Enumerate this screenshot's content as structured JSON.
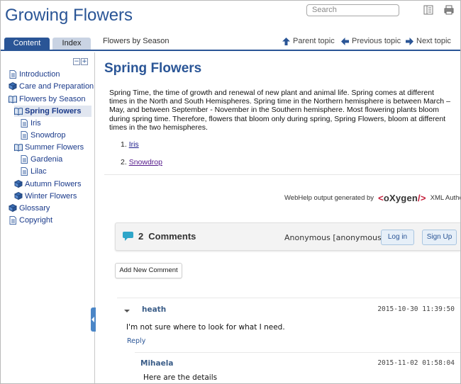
{
  "header": {
    "title": "Growing Flowers",
    "search_placeholder": "Search",
    "toc_icon": "toc-icon",
    "print_icon": "print-icon"
  },
  "tabs": {
    "content": "Content",
    "index": "Index"
  },
  "breadcrumb": "Flowers by Season",
  "nav": {
    "parent": "Parent topic",
    "previous": "Previous topic",
    "next": "Next topic"
  },
  "toc": {
    "items": [
      {
        "label": "Introduction",
        "icon": "page-icon"
      },
      {
        "label": "Care and Preparation",
        "icon": "book-closed-icon"
      },
      {
        "label": "Flowers by Season",
        "icon": "book-open-icon"
      },
      {
        "label": "Spring Flowers",
        "icon": "book-open-icon"
      },
      {
        "label": "Iris",
        "icon": "page-icon"
      },
      {
        "label": "Snowdrop",
        "icon": "page-icon"
      },
      {
        "label": "Summer Flowers",
        "icon": "book-open-icon"
      },
      {
        "label": "Gardenia",
        "icon": "page-icon"
      },
      {
        "label": "Lilac",
        "icon": "page-icon"
      },
      {
        "label": "Autumn Flowers",
        "icon": "book-closed-icon"
      },
      {
        "label": "Winter Flowers",
        "icon": "book-closed-icon"
      },
      {
        "label": "Glossary",
        "icon": "book-closed-icon"
      },
      {
        "label": "Copyright",
        "icon": "page-icon"
      }
    ]
  },
  "topic": {
    "title": "Spring Flowers",
    "body": "Spring Time, the time of growth and renewal of new plant and animal life. Spring comes at different times in the North and South Hemispheres. Spring time in the Northern hemisphere is between March – May, and between September - November in the Southern hemisphere. Most flowering plants bloom during spring time. Therefore, flowers that bloom only during spring, Spring Flowers, bloom at different times in the two hemispheres.",
    "list": [
      {
        "num": "1.",
        "label": "Iris"
      },
      {
        "num": "2.",
        "label": "Snowdrop"
      }
    ]
  },
  "footer": {
    "generated_text": "WebHelp output generated by",
    "logo_text": "oXygen",
    "suffix": "XML Author"
  },
  "comments": {
    "count": "2",
    "label": "Comments",
    "user": "Anonymous [anonymous]",
    "login": "Log in",
    "signup": "Sign Up",
    "add": "Add New Comment",
    "items": [
      {
        "author": "heath",
        "date": "2015-10-30 11:39:50",
        "text": "I'm not sure where to look for what I need.",
        "reply": "Reply"
      },
      {
        "author": "Mihaela",
        "date": "2015-11-02 01:58:04",
        "text": "Here are the details"
      }
    ]
  },
  "colors": {
    "accent": "#2a5596",
    "tab_inactive": "#c9d3e3",
    "selected_bg": "#e1e6f0"
  }
}
